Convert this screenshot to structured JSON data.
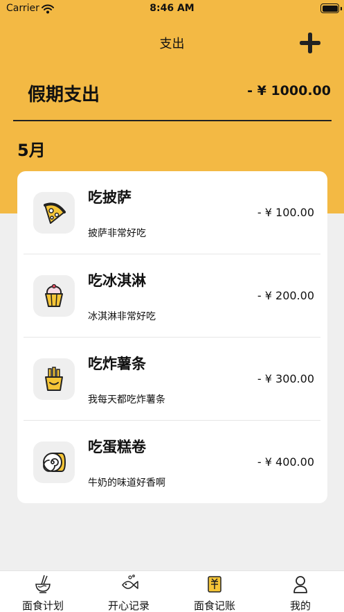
{
  "status_bar": {
    "carrier": "Carrier",
    "time": "8:46 AM"
  },
  "nav": {
    "title": "支出",
    "add_icon": "plus-icon"
  },
  "summary": {
    "title": "假期支出",
    "amount": "- ¥ 1000.00"
  },
  "month": "5月",
  "expenses": [
    {
      "title": "吃披萨",
      "amount": "- ¥ 100.00",
      "desc": "披萨非常好吃",
      "icon": "pizza-icon"
    },
    {
      "title": "吃冰淇淋",
      "amount": "- ¥ 200.00",
      "desc": "冰淇淋非常好吃",
      "icon": "ice-cream-icon"
    },
    {
      "title": "吃炸薯条",
      "amount": "- ¥ 300.00",
      "desc": "我每天都吃炸薯条",
      "icon": "fries-icon"
    },
    {
      "title": "吃蛋糕卷",
      "amount": "- ¥ 400.00",
      "desc": "牛奶的味道好香啊",
      "icon": "cake-roll-icon"
    }
  ],
  "tabs": [
    {
      "label": "面食计划",
      "icon": "noodle-bowl-icon"
    },
    {
      "label": "开心记录",
      "icon": "fish-icon"
    },
    {
      "label": "面食记账",
      "icon": "ledger-icon"
    },
    {
      "label": "我的",
      "icon": "user-icon"
    }
  ],
  "colors": {
    "header": "#f3b944",
    "background": "#efefef",
    "card": "#ffffff",
    "icon_accent": "#f5c537"
  }
}
